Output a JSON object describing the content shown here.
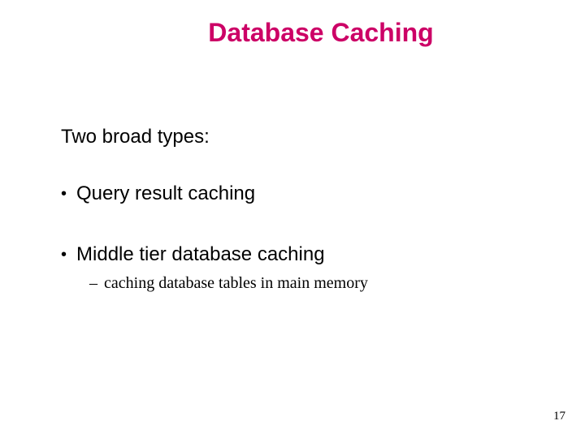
{
  "slide": {
    "title": "Database Caching",
    "intro": "Two broad types:",
    "bullets": [
      {
        "text": "Query result caching"
      },
      {
        "text": "Middle tier database caching"
      }
    ],
    "subitem": "caching database tables in main memory",
    "page_number": "17"
  }
}
